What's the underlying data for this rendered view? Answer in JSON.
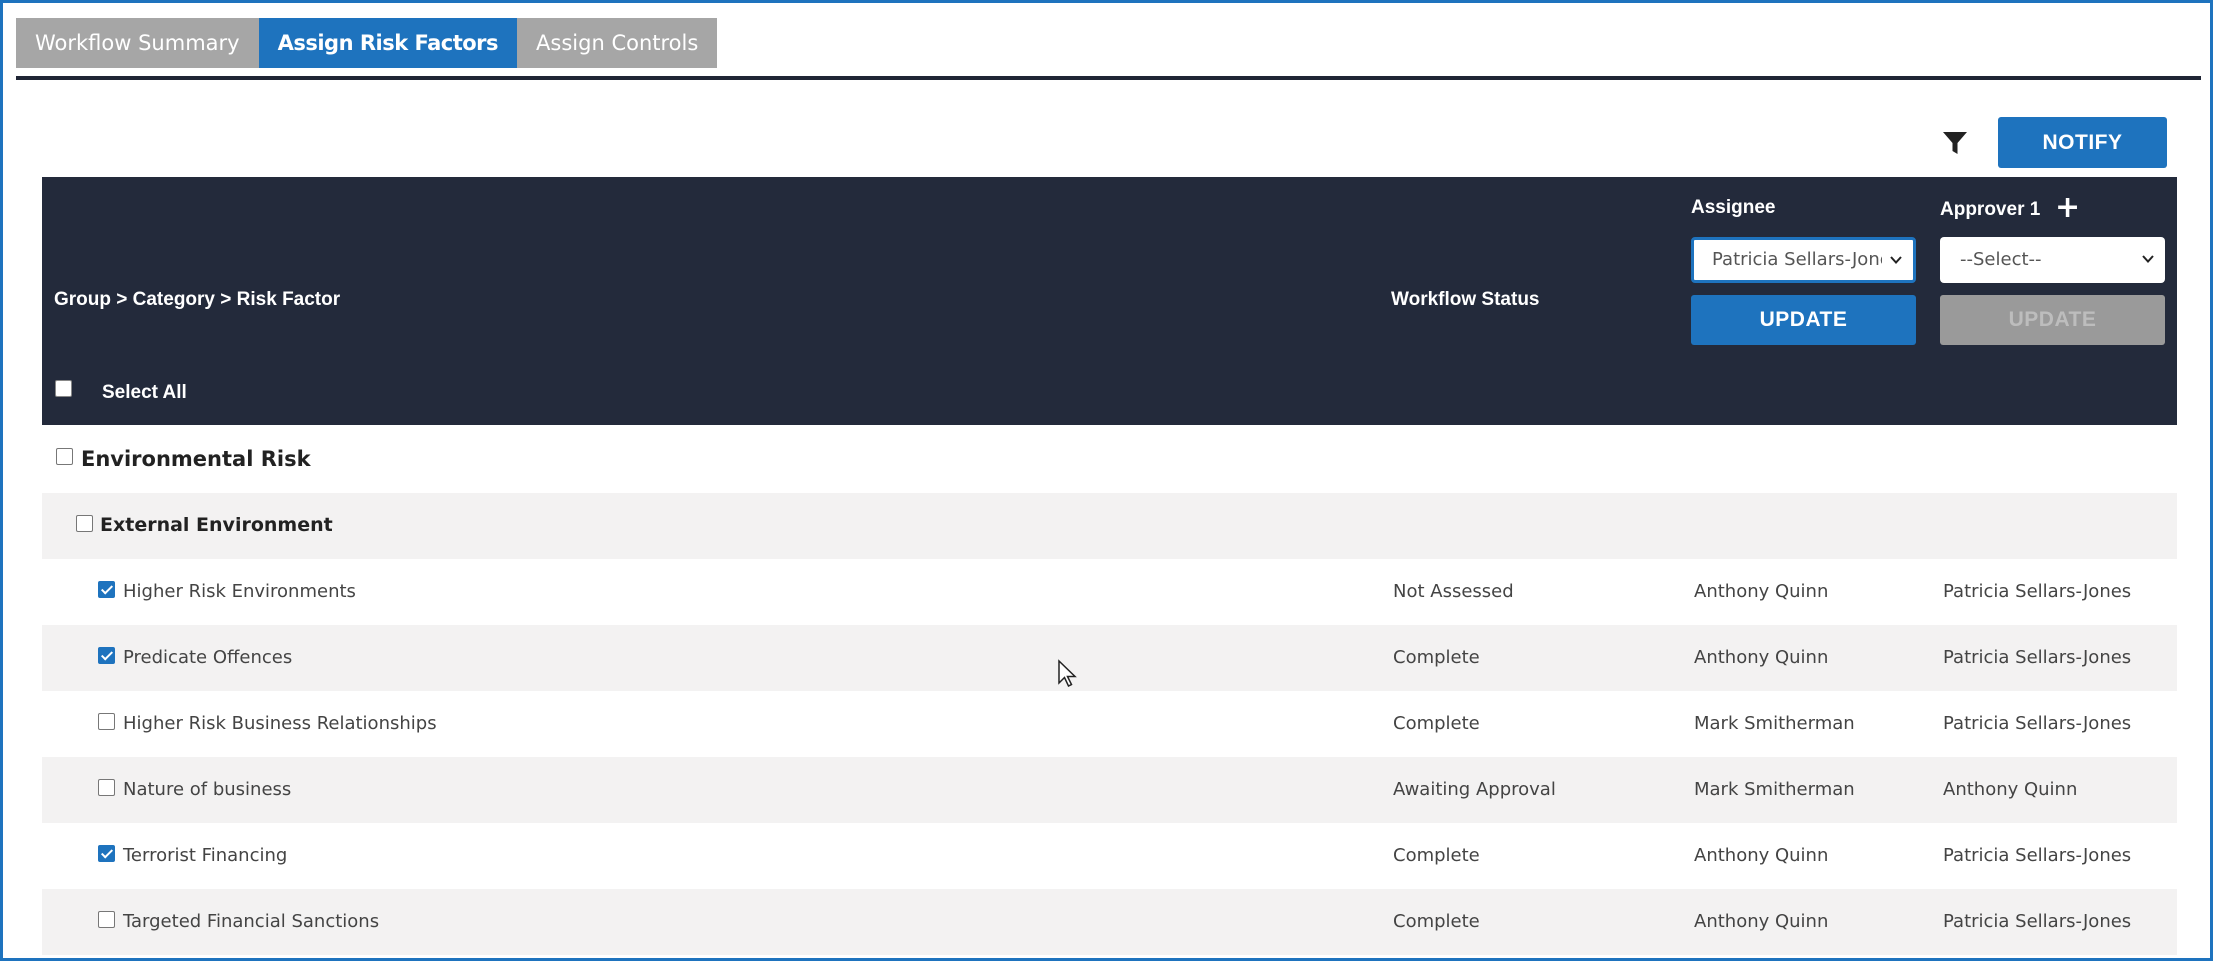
{
  "tabs": [
    {
      "label": "Workflow Summary",
      "active": false
    },
    {
      "label": "Assign Risk Factors",
      "active": true
    },
    {
      "label": "Assign Controls",
      "active": false
    }
  ],
  "toolbar": {
    "notify_label": "NOTIFY",
    "filter_icon": "filter-icon"
  },
  "table_header": {
    "group_col": "Group > Category > Risk Factor",
    "status_col": "Workflow Status",
    "assignee_col": "Assignee",
    "approver_col": "Approver 1",
    "approver_add": "+",
    "assignee_select_value": "Patricia Sellars-Jones",
    "approver_select_value": "--Select--",
    "update_label": "UPDATE",
    "select_all_label": "Select All"
  },
  "group": {
    "name": "Environmental Risk",
    "checked": false
  },
  "category": {
    "name": "External Environment",
    "checked": false
  },
  "rows": [
    {
      "name": "Higher Risk Environments",
      "checked": true,
      "status": "Not Assessed",
      "assignee": "Anthony Quinn",
      "approver": "Patricia Sellars-Jones"
    },
    {
      "name": "Predicate Offences",
      "checked": true,
      "status": "Complete",
      "assignee": "Anthony Quinn",
      "approver": "Patricia Sellars-Jones"
    },
    {
      "name": "Higher Risk Business Relationships",
      "checked": false,
      "status": "Complete",
      "assignee": "Mark Smitherman",
      "approver": "Patricia Sellars-Jones"
    },
    {
      "name": "Nature of business",
      "checked": false,
      "status": "Awaiting Approval",
      "assignee": "Mark Smitherman",
      "approver": "Anthony Quinn"
    },
    {
      "name": "Terrorist Financing",
      "checked": true,
      "status": "Complete",
      "assignee": "Anthony Quinn",
      "approver": "Patricia Sellars-Jones"
    },
    {
      "name": "Targeted Financial Sanctions",
      "checked": false,
      "status": "Complete",
      "assignee": "Anthony Quinn",
      "approver": "Patricia Sellars-Jones"
    }
  ],
  "colors": {
    "accent": "#1e73be",
    "header_bg": "#232a3b",
    "tab_inactive": "#a6a6a6",
    "row_alt": "#f3f2f2"
  }
}
